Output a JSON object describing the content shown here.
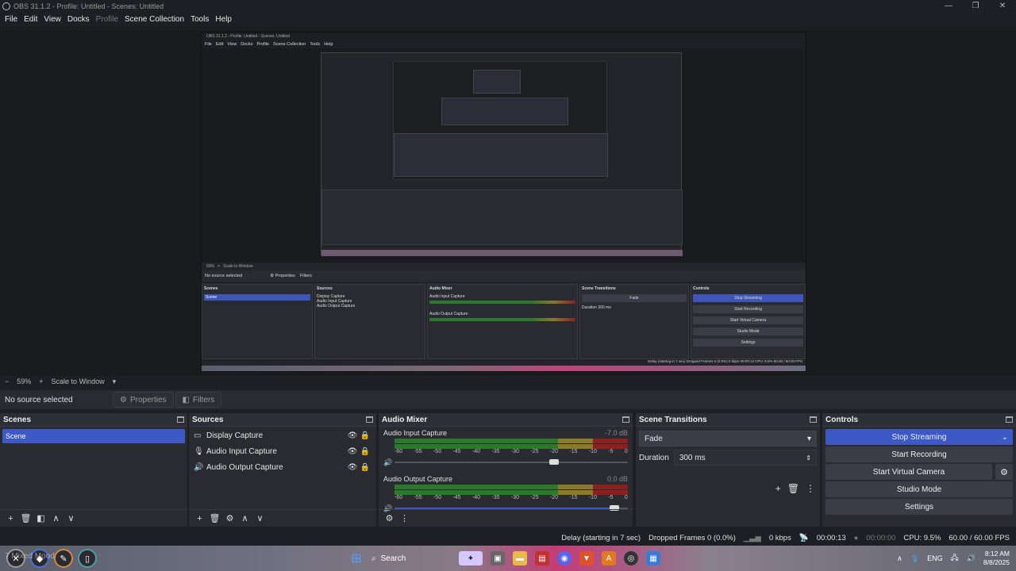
{
  "window": {
    "title": "OBS 31.1.2 - Profile: Untitled - Scenes: Untitled"
  },
  "menu": [
    "File",
    "Edit",
    "View",
    "Docks",
    "Profile",
    "Scene Collection",
    "Tools",
    "Help"
  ],
  "zoom": {
    "minus": "−",
    "value": "59%",
    "plus": "+",
    "mode": "Scale to Window"
  },
  "source_bar": {
    "no_source": "No source selected",
    "properties": "Properties",
    "filters": "Filters"
  },
  "scenes": {
    "title": "Scenes",
    "items": [
      "Scene"
    ]
  },
  "sources": {
    "title": "Sources",
    "items": [
      {
        "name": "Display Capture",
        "icon": "monitor-icon"
      },
      {
        "name": "Audio Input Capture",
        "icon": "microphone-icon"
      },
      {
        "name": "Audio Output Capture",
        "icon": "speaker-icon"
      }
    ]
  },
  "mixer": {
    "title": "Audio Mixer",
    "channels": [
      {
        "name": "Audio Input Capture",
        "db": "-7.0 dB",
        "volume": 0.6
      },
      {
        "name": "Audio Output Capture",
        "db": "0.0 dB",
        "volume": 1.0
      }
    ],
    "ticks": [
      "-60",
      "-55",
      "-50",
      "-45",
      "-40",
      "-35",
      "-30",
      "-25",
      "-20",
      "-15",
      "-10",
      "-5",
      "0"
    ]
  },
  "transitions": {
    "title": "Scene Transitions",
    "selected": "Fade",
    "duration_label": "Duration",
    "duration_value": "300 ms"
  },
  "controls": {
    "title": "Controls",
    "stop_streaming": "Stop Streaming",
    "start_recording": "Start Recording",
    "start_virtual_camera": "Start Virtual Camera",
    "studio_mode": "Studio Mode",
    "settings": "Settings"
  },
  "status": {
    "delay": "Delay (starting in 7 sec)",
    "dropped": "Dropped Frames 0 (0.0%)",
    "kbps": "0 kbps",
    "stream_time": "00:00:13",
    "rec_time": "00:00:00",
    "cpu": "CPU: 9.5%",
    "fps": "60.00 / 60.00 FPS"
  },
  "preview_nested": {
    "title": "OBS 31.1.2 - Profile: Untitled - Scenes: Untitled",
    "no_source": "No source selected",
    "properties": "Properties",
    "filters": "Filters",
    "zoom": "59%",
    "scale": "Scale to Window",
    "scene": "Scene",
    "stop": "Stop Streaming",
    "rec": "Start Recording",
    "vcam": "Start Virtual Camera",
    "studio": "Studio Mode",
    "settings": "Settings",
    "fade": "Fade",
    "duration": "Duration",
    "dur_val": "300 ms",
    "status": "Delay (starting in 7 sec)   Dropped Frames 0 (0.0%)   0 kbps   00:00:13   CPU: 9.5%   60.00 / 60.00 FPS"
  },
  "taskbar": {
    "overlay_text": "7 Mixed Mood",
    "search": "Search",
    "lang": "ENG",
    "time": "8:12 AM",
    "date": "8/8/2025"
  }
}
